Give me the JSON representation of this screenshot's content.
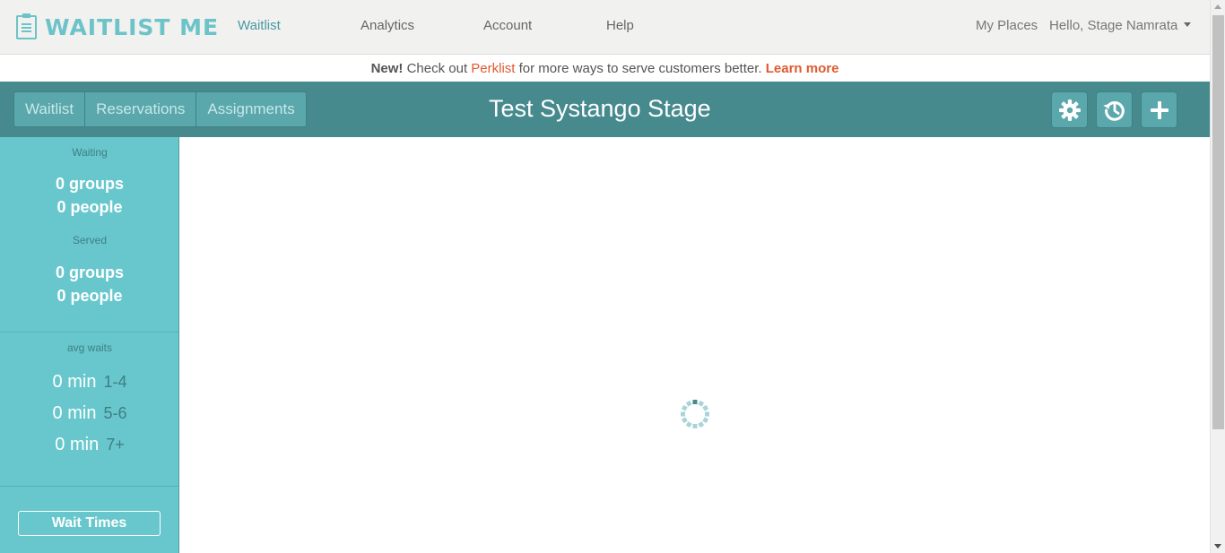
{
  "app": {
    "logo_text": "WAITLIST ME"
  },
  "topnav": {
    "links": [
      "Waitlist",
      "Analytics",
      "Account",
      "Help"
    ],
    "my_places": "My Places",
    "user_greeting": "Hello, Stage Namrata"
  },
  "announcement": {
    "new_label": "New!",
    "text_1": " Check out ",
    "product": "Perklist",
    "text_2": " for more ways to serve customers better. ",
    "learn_more": "Learn more"
  },
  "toolbar": {
    "tabs": [
      "Waitlist",
      "Reservations",
      "Assignments"
    ],
    "place_title": "Test Systango Stage",
    "buttons": [
      "gear-icon",
      "history-icon",
      "plus-icon"
    ]
  },
  "sidebar": {
    "waiting_label": "Waiting",
    "waiting_groups": "0 groups",
    "waiting_people": "0 people",
    "served_label": "Served",
    "served_groups": "0 groups",
    "served_people": "0 people",
    "avg_waits_label": "avg waits",
    "avg_waits": [
      {
        "min": "0 min",
        "range": "1-4"
      },
      {
        "min": "0 min",
        "range": "5-6"
      },
      {
        "min": "0 min",
        "range": "7+"
      }
    ],
    "wait_times_button": "Wait Times"
  },
  "colors": {
    "brand": "#6cc3c8",
    "toolbar_bg": "#468a8e",
    "sidebar_bg": "#68c7cc",
    "accent_orange": "#e05a2f"
  }
}
